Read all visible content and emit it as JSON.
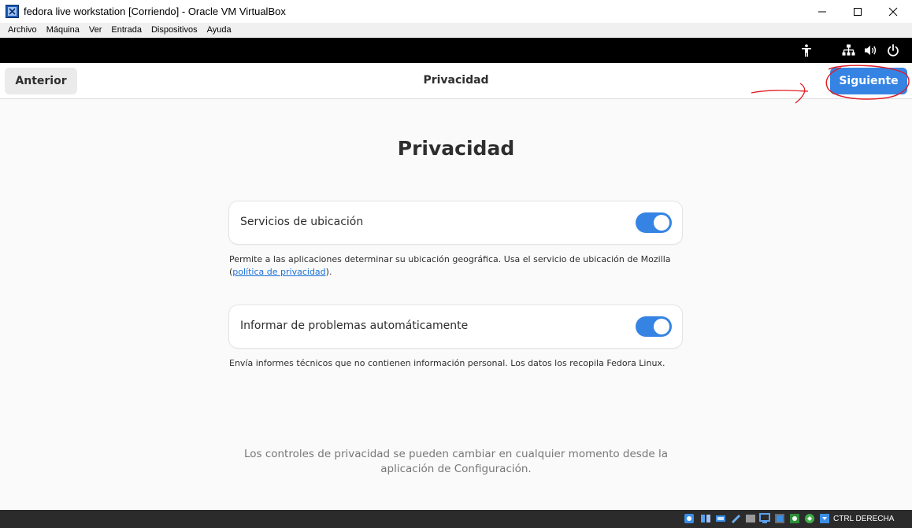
{
  "window": {
    "title": "fedora live workstation [Corriendo] - Oracle VM VirtualBox",
    "app_icon": "virtualbox-icon",
    "controls": [
      "minimize-icon",
      "maximize-icon",
      "close-icon"
    ]
  },
  "menubar": {
    "items": [
      "Archivo",
      "Máquina",
      "Ver",
      "Entrada",
      "Dispositivos",
      "Ayuda"
    ]
  },
  "gnome_topbar": {
    "icons": [
      "accessibility-icon",
      "network-wired-icon",
      "volume-icon",
      "power-icon"
    ]
  },
  "header": {
    "back_label": "Anterior",
    "title": "Privacidad",
    "next_label": "Siguiente"
  },
  "content": {
    "heading": "Privacidad",
    "settings": [
      {
        "label": "Servicios de ubicación",
        "enabled": true,
        "description_line1": "Permite a las aplicaciones determinar su ubicación geográfica. Usa el servicio de ubicación de Mozilla",
        "description_open": "(",
        "description_link": "política de privacidad",
        "description_close": ")."
      },
      {
        "label": "Informar de problemas automáticamente",
        "enabled": true,
        "description": "Envía informes técnicos que no contienen información personal. Los datos los recopila Fedora Linux."
      }
    ],
    "footer_line1": "Los controles de privacidad se pueden cambiar en cualquier momento desde la",
    "footer_line2": "aplicación de Configuración."
  },
  "statusbar": {
    "icons": [
      "storage-icon",
      "optical-drive-icon",
      "audio-icon",
      "network-icon",
      "usb-icon",
      "shared-folder-icon",
      "display-icon",
      "recording-icon",
      "cpu-icon",
      "mouse-integration-icon",
      "keyboard-icon"
    ],
    "host_key": "CTRL DERECHA"
  },
  "colors": {
    "accent": "#3584e4",
    "annotation": "#e01b24",
    "page_bg": "#fafafa",
    "topbar_bg": "#000000"
  }
}
